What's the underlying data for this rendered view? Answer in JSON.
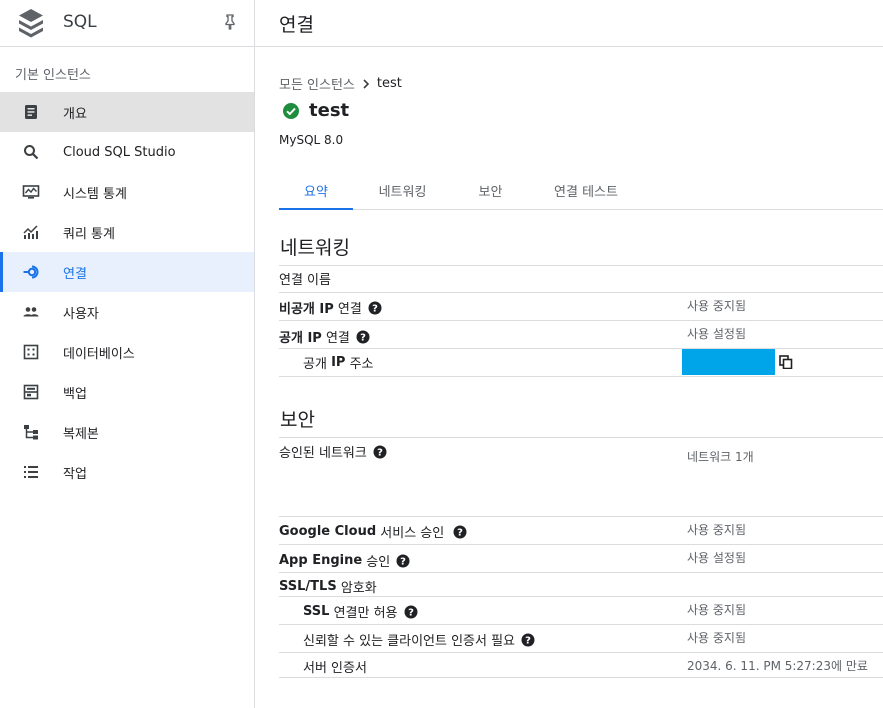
{
  "sidebar": {
    "title": "SQL",
    "section_label": "기본 인스턴스",
    "items": [
      {
        "label": "개요",
        "icon": "overview-icon"
      },
      {
        "label": "Cloud SQL Studio",
        "icon": "search-icon"
      },
      {
        "label": "시스템 통계",
        "icon": "monitor-icon"
      },
      {
        "label": "쿼리 통계",
        "icon": "query-insights-icon"
      },
      {
        "label": "연결",
        "icon": "connections-icon"
      },
      {
        "label": "사용자",
        "icon": "users-icon"
      },
      {
        "label": "데이터베이스",
        "icon": "database-icon"
      },
      {
        "label": "백업",
        "icon": "backup-icon"
      },
      {
        "label": "복제본",
        "icon": "replicas-icon"
      },
      {
        "label": "작업",
        "icon": "operations-icon"
      }
    ]
  },
  "header": {
    "title": "연결"
  },
  "breadcrumb": {
    "parent": "모든 인스턴스",
    "current": "test"
  },
  "instance": {
    "name": "test",
    "version": "MySQL 8.0",
    "status_icon": "check-circle-icon"
  },
  "tabs": [
    "요약",
    "네트워킹",
    "보안",
    "연결 테스트"
  ],
  "networking": {
    "title": "네트워킹",
    "connection_name_label": "연결 이름",
    "private_ip_label_bold": "비공개 IP",
    "private_ip_label_rest": " 연결",
    "private_ip_value": "사용 중지됨",
    "public_ip_label_bold": "공개 IP",
    "public_ip_label_rest": " 연결",
    "public_ip_value": "사용 설정됨",
    "public_ip_address_label_pre": "공개 ",
    "public_ip_address_label_bold": "IP",
    "public_ip_address_label_post": " 주소"
  },
  "security": {
    "title": "보안",
    "authorized_networks_label": "승인된 네트워크",
    "authorized_networks_value": "네트워크 1개",
    "gcloud_label_bold": "Google Cloud",
    "gcloud_label_rest": " 서비스 승인",
    "gcloud_value": "사용 중지됨",
    "appengine_label_bold": "App Engine",
    "appengine_label_rest": " 승인",
    "appengine_value": "사용 설정됨",
    "ssl_label_bold": "SSL/TLS",
    "ssl_label_rest": " 암호화",
    "ssl_only_label_bold": "SSL",
    "ssl_only_label_rest": " 연결만 허용",
    "ssl_only_value": "사용 중지됨",
    "trusted_client_label": "신뢰할 수 있는 클라이언트 인증서 필요",
    "trusted_client_value": "사용 중지됨",
    "server_cert_label": "서버 인증서",
    "server_cert_value": "2034. 6. 11. PM 5:27:23에 만료"
  },
  "colors": {
    "accent": "#1a73e8",
    "ip_redaction": "#00a4e8",
    "status_ok": "#1e8e3e"
  }
}
